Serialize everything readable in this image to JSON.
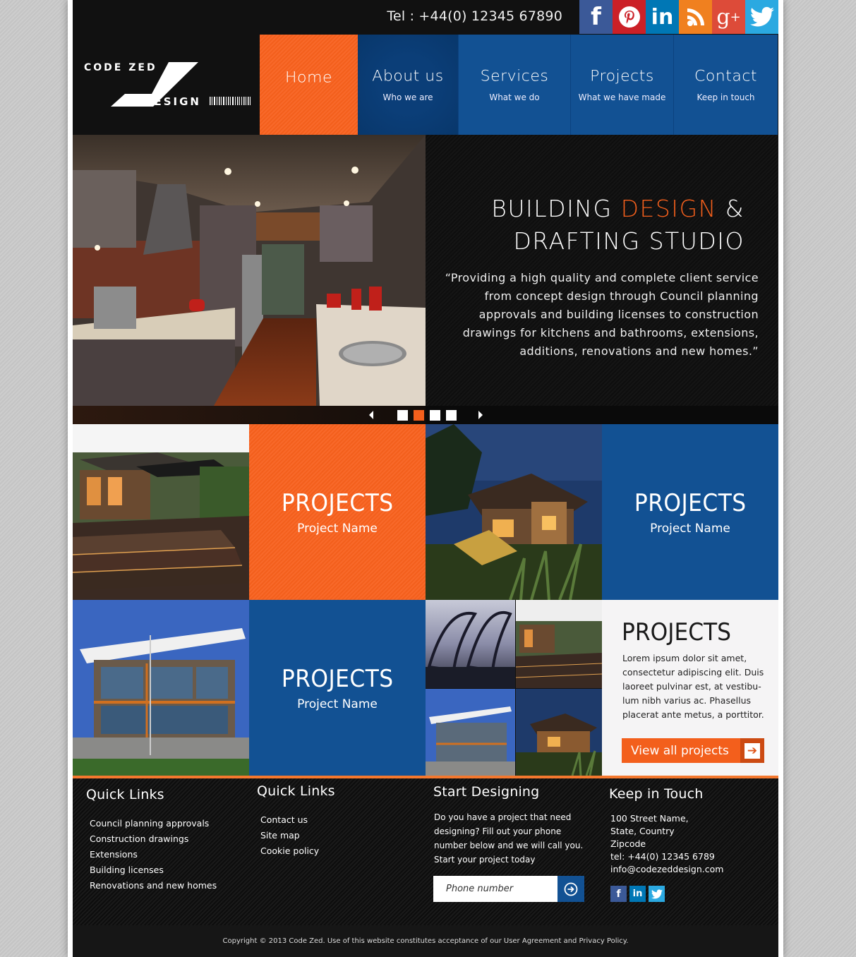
{
  "topbar": {
    "tel": "Tel :  +44(0) 12345 67890",
    "social": [
      "facebook",
      "pinterest",
      "linkedin",
      "rss",
      "google-plus",
      "twitter"
    ]
  },
  "logo": {
    "line1": "CODE ZED",
    "line2": "DESIGN"
  },
  "nav": [
    {
      "label": "Home",
      "sub": ""
    },
    {
      "label": "About us",
      "sub": "Who we are"
    },
    {
      "label": "Services",
      "sub": "What we do"
    },
    {
      "label": "Projects",
      "sub": "What we have made"
    },
    {
      "label": "Contact",
      "sub": "Keep in touch"
    }
  ],
  "hero": {
    "title_part1": "BUILDING ",
    "title_accent": "DESIGN",
    "title_part2": " &",
    "title_line2": "DRAFTING STUDIO",
    "quote": "“Providing a high quality and complete client service from concept design through Council planning approvals and building licenses to construction drawings for kitchens and bathrooms, extensions, additions, renovations and new homes.”",
    "slides": 4,
    "active_slide": 2
  },
  "grid": {
    "tiles": [
      {
        "title": "PROJECTS",
        "name": "Project Name"
      },
      {
        "title": "PROJECTS",
        "name": "Project Name"
      },
      {
        "title": "PROJECTS",
        "name": "Project Name"
      }
    ],
    "info": {
      "title": "PROJECTS",
      "text": "Lorem ipsum dolor sit amet, consectetur adipiscing elit. Duis laoreet pulvinar est, at vestibu-lum nibh varius ac. Phasellus placerat ante metus, a porttitor.",
      "button": "View all projects"
    }
  },
  "footer": {
    "col1": {
      "title": "Quick Links",
      "links": [
        "Council planning approvals",
        "Construction drawings",
        "Extensions",
        "Building licenses",
        "Renovations and new homes"
      ]
    },
    "col2": {
      "title": "Quick Links",
      "links": [
        "Contact us",
        "Site map",
        "Cookie policy"
      ]
    },
    "col3": {
      "title": "Start Designing",
      "text": "Do you have a project that need designing? Fill out your phone number below and we will call you. Start your project today",
      "placeholder": "Phone number"
    },
    "col4": {
      "title": "Keep in Touch",
      "address": [
        "100 Street Name,",
        "State, Country",
        "Zipcode",
        "tel: +44(0) 12345 6789",
        "info@codezeddesign.com"
      ]
    },
    "copyright": "Copyright © 2013 Code Zed. Use of this website constitutes acceptance of our User Agreement and Privacy Policy."
  },
  "colors": {
    "orange": "#f35f1c",
    "blue": "#125193",
    "dark_blue": "#08376b",
    "dark": "#111111"
  }
}
